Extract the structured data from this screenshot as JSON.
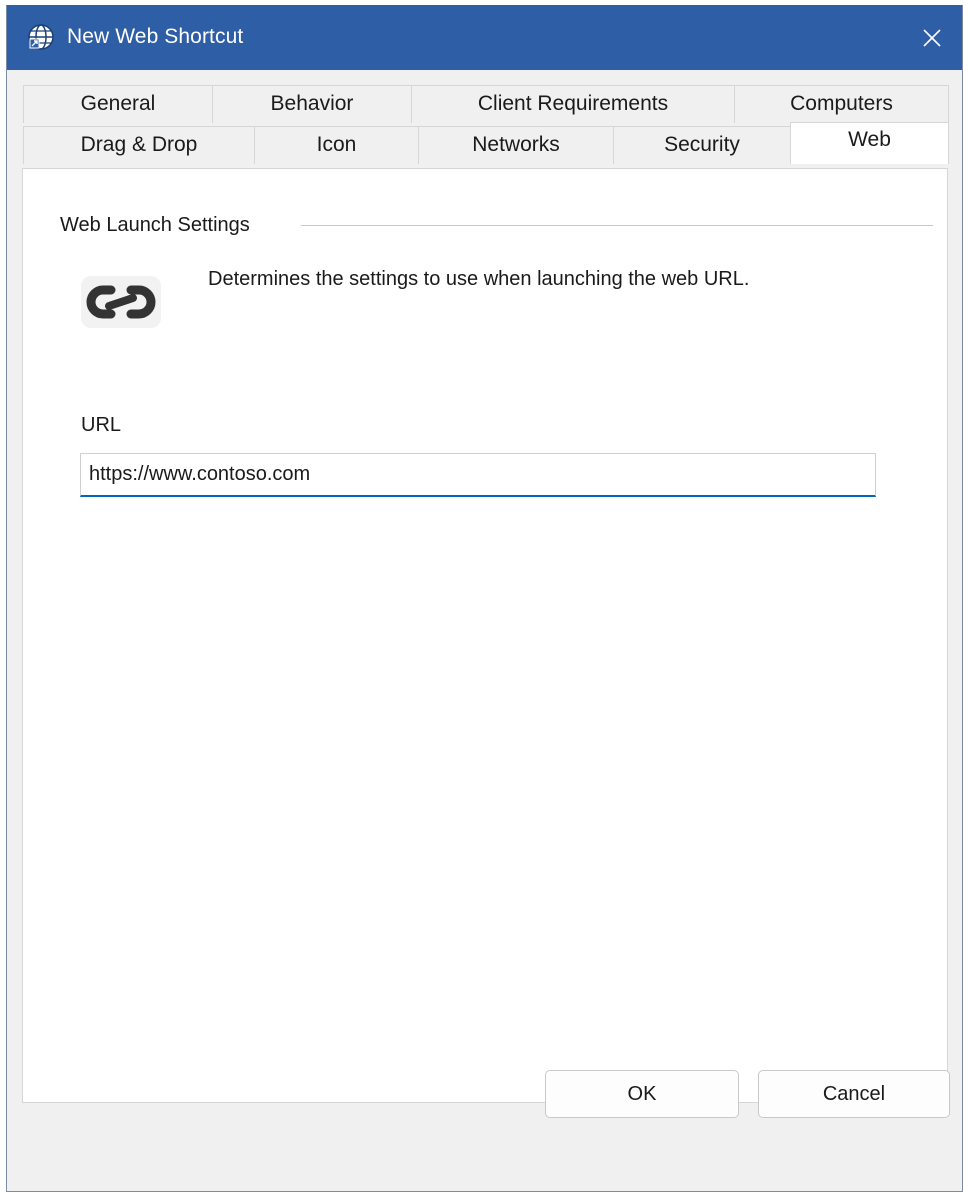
{
  "window": {
    "title": "New Web Shortcut",
    "title_icon": "globe-icon",
    "close_icon": "close-icon"
  },
  "tabs": {
    "row1": [
      {
        "label": "General"
      },
      {
        "label": "Behavior"
      },
      {
        "label": "Client Requirements"
      },
      {
        "label": "Computers"
      }
    ],
    "row2": [
      {
        "label": "Drag & Drop"
      },
      {
        "label": "Icon"
      },
      {
        "label": "Networks"
      },
      {
        "label": "Security"
      },
      {
        "label": "Web",
        "selected": true
      }
    ]
  },
  "web_settings": {
    "group_label": "Web Launch Settings",
    "icon": "link-icon",
    "description": "Determines the settings to use when launching the web URL.",
    "url_label": "URL",
    "url_value": "https://www.contoso.com"
  },
  "buttons": {
    "ok": "OK",
    "cancel": "Cancel"
  },
  "colors": {
    "titlebar": "#2e5ea6",
    "focus_underline": "#0067c0"
  }
}
